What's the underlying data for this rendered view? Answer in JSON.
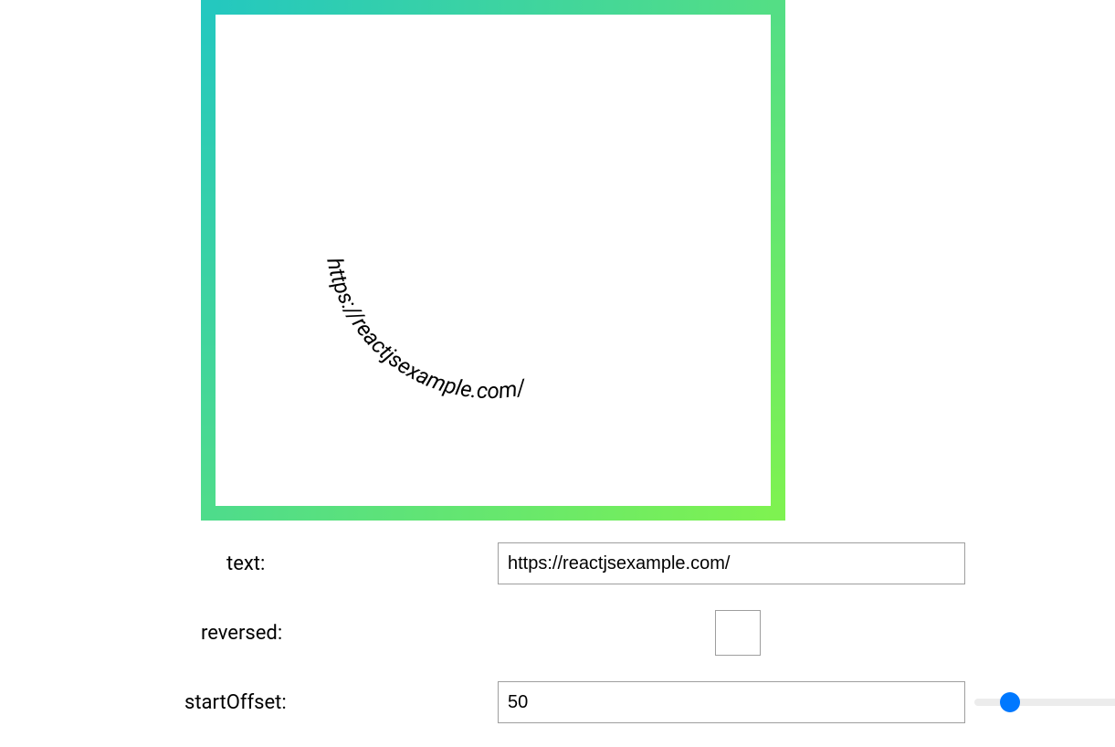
{
  "preview": {
    "curve_text": "https://reactjsexample.com/",
    "start_offset_percent": "5%"
  },
  "controls": {
    "text_label": "text:",
    "text_value": "https://reactjsexample.com/",
    "reversed_label": "reversed:",
    "reversed_checked": false,
    "startOffset_label": "startOffset:",
    "startOffset_value": "50",
    "slider_min": "0",
    "slider_max": "500",
    "slider_value": "50"
  }
}
